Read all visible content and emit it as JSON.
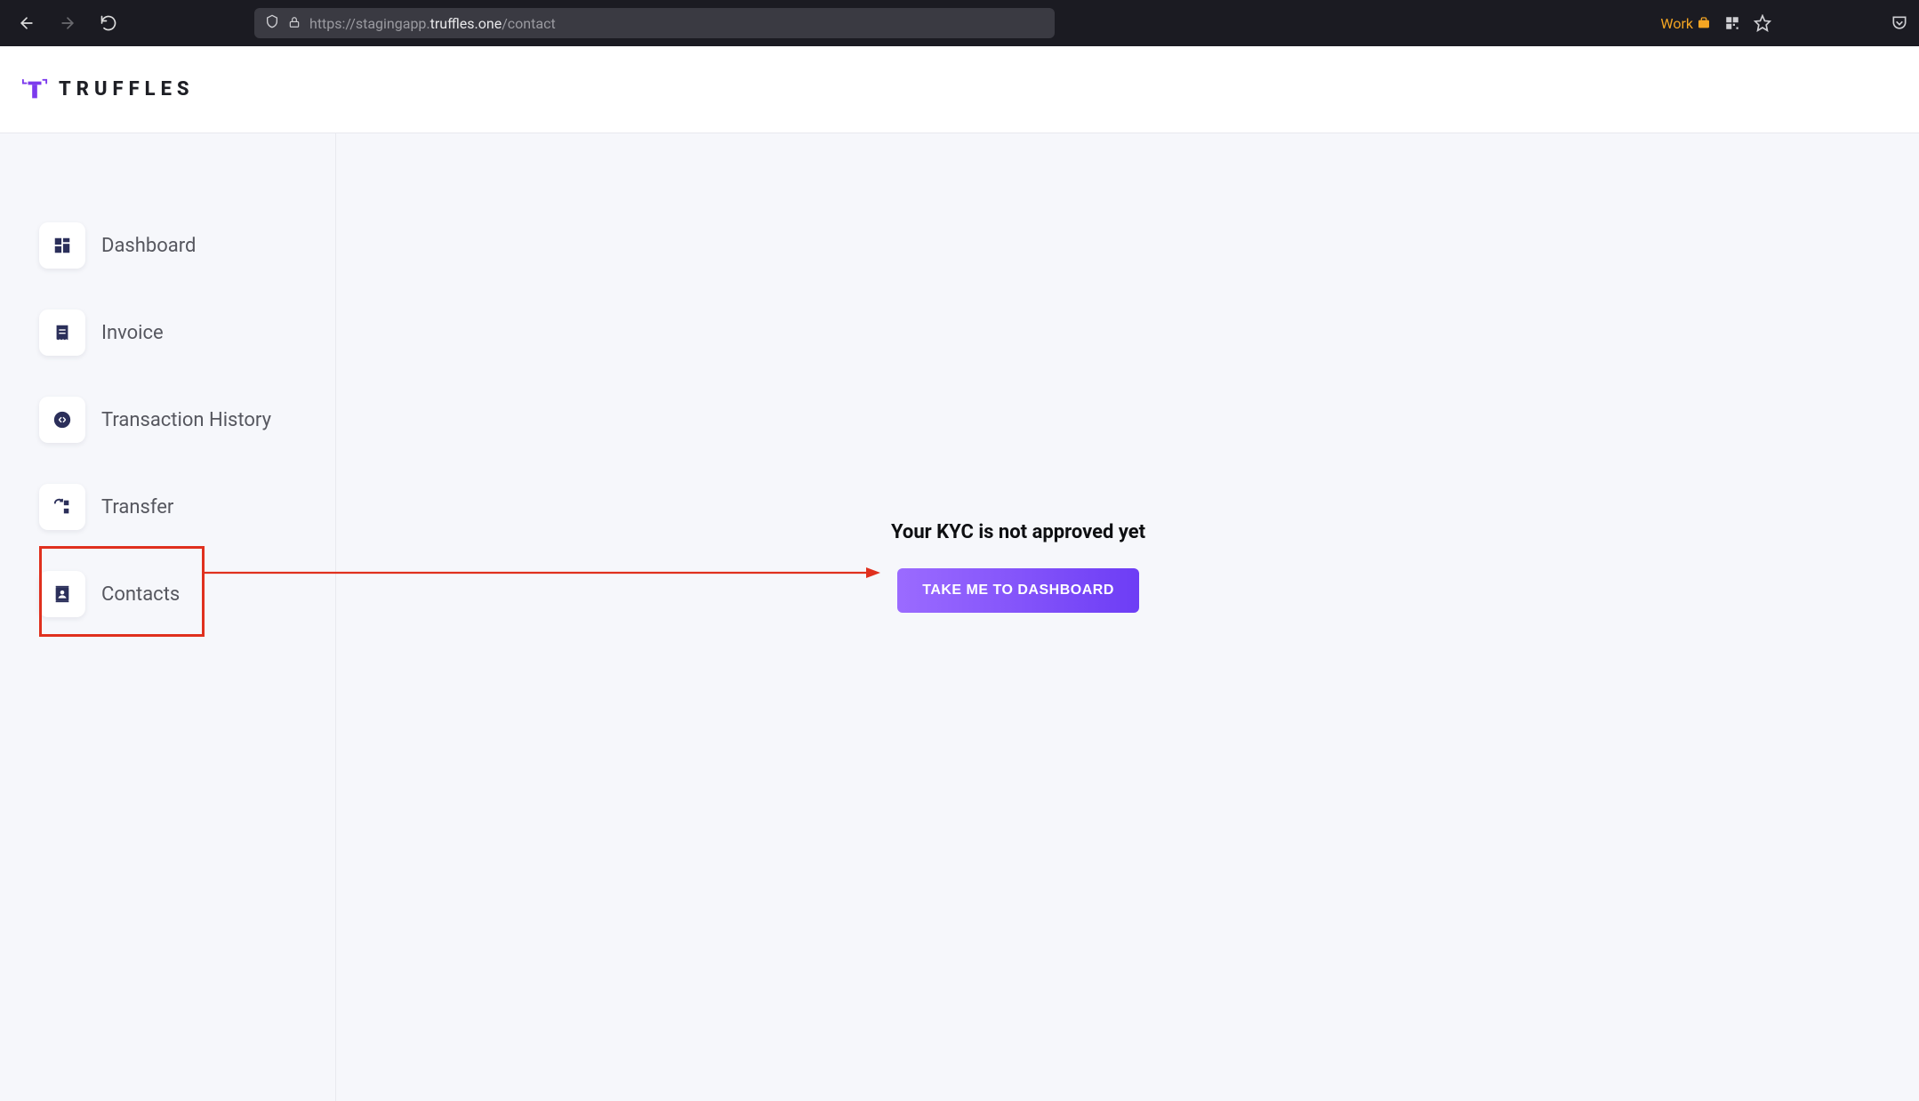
{
  "browser": {
    "url_scheme": "https://stagingapp.",
    "url_domain": "truffles.one",
    "url_path": "/contact",
    "work_label": "Work"
  },
  "brand": {
    "name": "TRUFFLES"
  },
  "sidebar": {
    "items": [
      {
        "label": "Dashboard",
        "name": "sidebar-item-dashboard"
      },
      {
        "label": "Invoice",
        "name": "sidebar-item-invoice"
      },
      {
        "label": "Transaction History",
        "name": "sidebar-item-transaction-history"
      },
      {
        "label": "Transfer",
        "name": "sidebar-item-transfer"
      },
      {
        "label": "Contacts",
        "name": "sidebar-item-contacts"
      }
    ]
  },
  "content": {
    "kyc_message": "Your KYC is not approved yet",
    "dashboard_button": "TAKE ME TO DASHBOARD"
  },
  "annotation": {
    "highlight_color": "#e0301e"
  }
}
